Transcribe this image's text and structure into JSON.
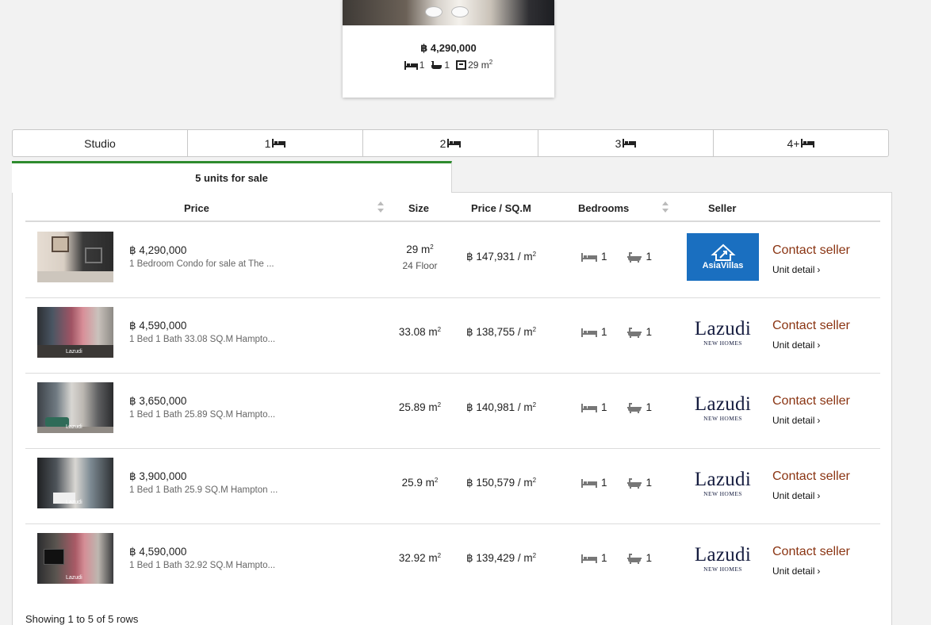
{
  "featured": {
    "price": "฿ 4,290,000",
    "bedrooms": "1",
    "bathrooms": "1",
    "area": "29 m",
    "area_sup": "2"
  },
  "bedroom_tabs": [
    {
      "label": "Studio",
      "icon": ""
    },
    {
      "label": "1",
      "icon": "bed-icon"
    },
    {
      "label": "2",
      "icon": "bed-icon"
    },
    {
      "label": "3",
      "icon": "bed-icon"
    },
    {
      "label": "4+",
      "icon": "bed-icon"
    }
  ],
  "units_tab": {
    "label": "5 units for sale"
  },
  "table": {
    "headers": {
      "price": "Price",
      "size": "Size",
      "price_per_sqm": "Price / SQ.M",
      "bedrooms": "Bedrooms",
      "seller": "Seller"
    },
    "rows": [
      {
        "price": "฿ 4,290,000",
        "description": "1 Bedroom Condo for sale at The ...",
        "size": "29 m",
        "size_sup": "2",
        "floor": "24 Floor",
        "price_per_sqm": "฿ 147,931 / m",
        "ppsqm_sup": "2",
        "bedrooms": "1",
        "bathrooms": "1",
        "seller": "AsiaVillas",
        "seller_sub": "",
        "contact": "Contact seller",
        "detail": "Unit detail"
      },
      {
        "price": "฿ 4,590,000",
        "description": "1 Bed 1 Bath 33.08 SQ.M Hampto...",
        "size": "33.08 m",
        "size_sup": "2",
        "floor": "",
        "price_per_sqm": "฿ 138,755 / m",
        "ppsqm_sup": "2",
        "bedrooms": "1",
        "bathrooms": "1",
        "seller": "Lazudi",
        "seller_sub": "NEW HOMES",
        "contact": "Contact seller",
        "detail": "Unit detail",
        "watermark": "Lazudi"
      },
      {
        "price": "฿ 3,650,000",
        "description": "1 Bed 1 Bath 25.89 SQ.M Hampto...",
        "size": "25.89 m",
        "size_sup": "2",
        "floor": "",
        "price_per_sqm": "฿ 140,981 / m",
        "ppsqm_sup": "2",
        "bedrooms": "1",
        "bathrooms": "1",
        "seller": "Lazudi",
        "seller_sub": "NEW HOMES",
        "contact": "Contact seller",
        "detail": "Unit detail",
        "watermark": "Lazudi"
      },
      {
        "price": "฿ 3,900,000",
        "description": "1 Bed 1 Bath 25.9 SQ.M Hampton ...",
        "size": "25.9 m",
        "size_sup": "2",
        "floor": "",
        "price_per_sqm": "฿ 150,579 / m",
        "ppsqm_sup": "2",
        "bedrooms": "1",
        "bathrooms": "1",
        "seller": "Lazudi",
        "seller_sub": "NEW HOMES",
        "contact": "Contact seller",
        "detail": "Unit detail",
        "watermark": "Lazudi"
      },
      {
        "price": "฿ 4,590,000",
        "description": "1 Bed 1 Bath 32.92 SQ.M Hampto...",
        "size": "32.92 m",
        "size_sup": "2",
        "floor": "",
        "price_per_sqm": "฿ 139,429 / m",
        "ppsqm_sup": "2",
        "bedrooms": "1",
        "bathrooms": "1",
        "seller": "Lazudi",
        "seller_sub": "NEW HOMES",
        "contact": "Contact seller",
        "detail": "Unit detail",
        "watermark": "Lazudi"
      }
    ]
  },
  "footer": {
    "showing": "Showing 1 to 5 of 5 rows"
  },
  "colors": {
    "active_tab": "#2e8b2e",
    "contact_link": "#8a3412",
    "asia_logo_bg": "#1a6fc0",
    "lazudi_navy": "#151c3f"
  }
}
